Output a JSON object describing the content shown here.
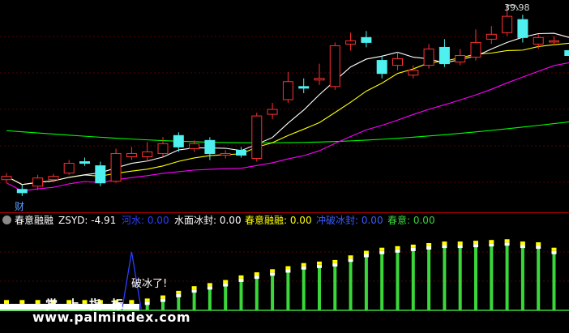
{
  "main_chart": {
    "max_price_label": "39.98",
    "tab_label": "财"
  },
  "indicator": {
    "name": "春意融融",
    "zsyd": "ZSYD: -4.91",
    "legend": [
      {
        "label": "河水: 0.00",
        "color": "#2a3fff"
      },
      {
        "label": "水面冰封: 0.00",
        "color": "#ffffff"
      },
      {
        "label": "春意融融: 0.00",
        "color": "#ffff00"
      },
      {
        "label": "冲破冰封: 0.00",
        "color": "#3a5cff"
      },
      {
        "label": "春意: 0.00",
        "color": "#3ad63a"
      }
    ],
    "annotation": "破冰了!",
    "banner_text": "赏上指标",
    "watermark_text": "www.palmindex.com"
  },
  "colors": {
    "up": "#ff3030",
    "down": "#4ef0f0",
    "ma5": "#ffffff",
    "ma10": "#ffff00",
    "ma20": "#ff00ff",
    "ma60": "#00ff00",
    "bar_green": "#3ad63a",
    "bar_cap": "#ffff00",
    "bar_top": "#ffffff"
  },
  "chart_data": [
    {
      "type": "candlestick",
      "title": "",
      "candles": [
        {
          "o": 19.2,
          "c": 19.6,
          "h": 20.0,
          "l": 18.8
        },
        {
          "o": 18.0,
          "c": 17.6,
          "h": 18.6,
          "l": 17.2
        },
        {
          "o": 18.4,
          "c": 19.4,
          "h": 19.8,
          "l": 17.9
        },
        {
          "o": 19.2,
          "c": 19.6,
          "h": 19.9,
          "l": 18.9
        },
        {
          "o": 20.0,
          "c": 21.2,
          "h": 21.6,
          "l": 19.8
        },
        {
          "o": 21.4,
          "c": 21.2,
          "h": 21.9,
          "l": 20.9
        },
        {
          "o": 20.9,
          "c": 18.8,
          "h": 21.4,
          "l": 18.4
        },
        {
          "o": 19.0,
          "c": 22.4,
          "h": 23.0,
          "l": 18.8
        },
        {
          "o": 22.0,
          "c": 22.4,
          "h": 23.2,
          "l": 21.6
        },
        {
          "o": 22.0,
          "c": 22.6,
          "h": 23.8,
          "l": 21.4
        },
        {
          "o": 22.4,
          "c": 23.6,
          "h": 24.4,
          "l": 22.0
        },
        {
          "o": 24.6,
          "c": 23.2,
          "h": 25.0,
          "l": 22.6
        },
        {
          "o": 23.0,
          "c": 23.6,
          "h": 24.0,
          "l": 22.6
        },
        {
          "o": 24.0,
          "c": 22.4,
          "h": 24.4,
          "l": 21.6
        },
        {
          "o": 22.2,
          "c": 22.4,
          "h": 22.8,
          "l": 21.8
        },
        {
          "o": 22.8,
          "c": 22.2,
          "h": 23.2,
          "l": 21.9
        },
        {
          "o": 21.8,
          "c": 27.0,
          "h": 27.4,
          "l": 21.4
        },
        {
          "o": 27.2,
          "c": 27.8,
          "h": 28.6,
          "l": 26.6
        },
        {
          "o": 29.0,
          "c": 31.2,
          "h": 32.4,
          "l": 28.6
        },
        {
          "o": 30.6,
          "c": 30.4,
          "h": 31.6,
          "l": 29.8
        },
        {
          "o": 31.4,
          "c": 31.6,
          "h": 33.4,
          "l": 30.8
        },
        {
          "o": 30.6,
          "c": 35.6,
          "h": 36.0,
          "l": 30.2
        },
        {
          "o": 35.8,
          "c": 36.2,
          "h": 37.2,
          "l": 35.0
        },
        {
          "o": 36.6,
          "c": 36.0,
          "h": 37.4,
          "l": 35.4
        },
        {
          "o": 33.8,
          "c": 32.2,
          "h": 34.4,
          "l": 31.6
        },
        {
          "o": 33.2,
          "c": 34.0,
          "h": 34.8,
          "l": 32.6
        },
        {
          "o": 32.0,
          "c": 32.6,
          "h": 33.2,
          "l": 31.6
        },
        {
          "o": 33.2,
          "c": 35.2,
          "h": 35.8,
          "l": 32.8
        },
        {
          "o": 35.4,
          "c": 33.4,
          "h": 36.4,
          "l": 33.0
        },
        {
          "o": 33.6,
          "c": 34.4,
          "h": 35.2,
          "l": 33.2
        },
        {
          "o": 34.2,
          "c": 36.0,
          "h": 37.6,
          "l": 33.8
        },
        {
          "o": 36.4,
          "c": 37.0,
          "h": 38.0,
          "l": 35.8
        },
        {
          "o": 37.2,
          "c": 39.2,
          "h": 39.98,
          "l": 36.8
        },
        {
          "o": 38.8,
          "c": 36.6,
          "h": 39.4,
          "l": 36.0
        },
        {
          "o": 35.8,
          "c": 36.6,
          "h": 37.0,
          "l": 35.2
        },
        {
          "o": 36.2,
          "c": 36.2,
          "h": 36.8,
          "l": 35.6
        },
        {
          "o": 35.0,
          "c": 34.4,
          "h": 35.4,
          "l": 33.6
        },
        {
          "o": 34.6,
          "c": 33.8,
          "h": 35.0,
          "l": 33.2
        },
        {
          "o": 33.6,
          "c": 33.4,
          "h": 34.0,
          "l": 32.8
        }
      ],
      "ylim": [
        15.6,
        41.0
      ]
    },
    {
      "type": "bar",
      "title": "",
      "values": [
        0.6,
        0.6,
        0.6,
        0.6,
        0.6,
        0.6,
        0.6,
        0.6,
        0.6,
        0.8,
        1.2,
        1.8,
        2.4,
        2.8,
        3.2,
        3.8,
        4.2,
        4.6,
        5.0,
        5.4,
        5.6,
        5.8,
        6.4,
        7.0,
        7.4,
        7.6,
        7.8,
        8.0,
        8.2,
        8.2,
        8.3,
        8.4,
        8.5,
        8.2,
        8.1,
        7.4
      ],
      "ylim": [
        0,
        10
      ],
      "spike_x": 8,
      "spike_value": 7.6
    }
  ]
}
